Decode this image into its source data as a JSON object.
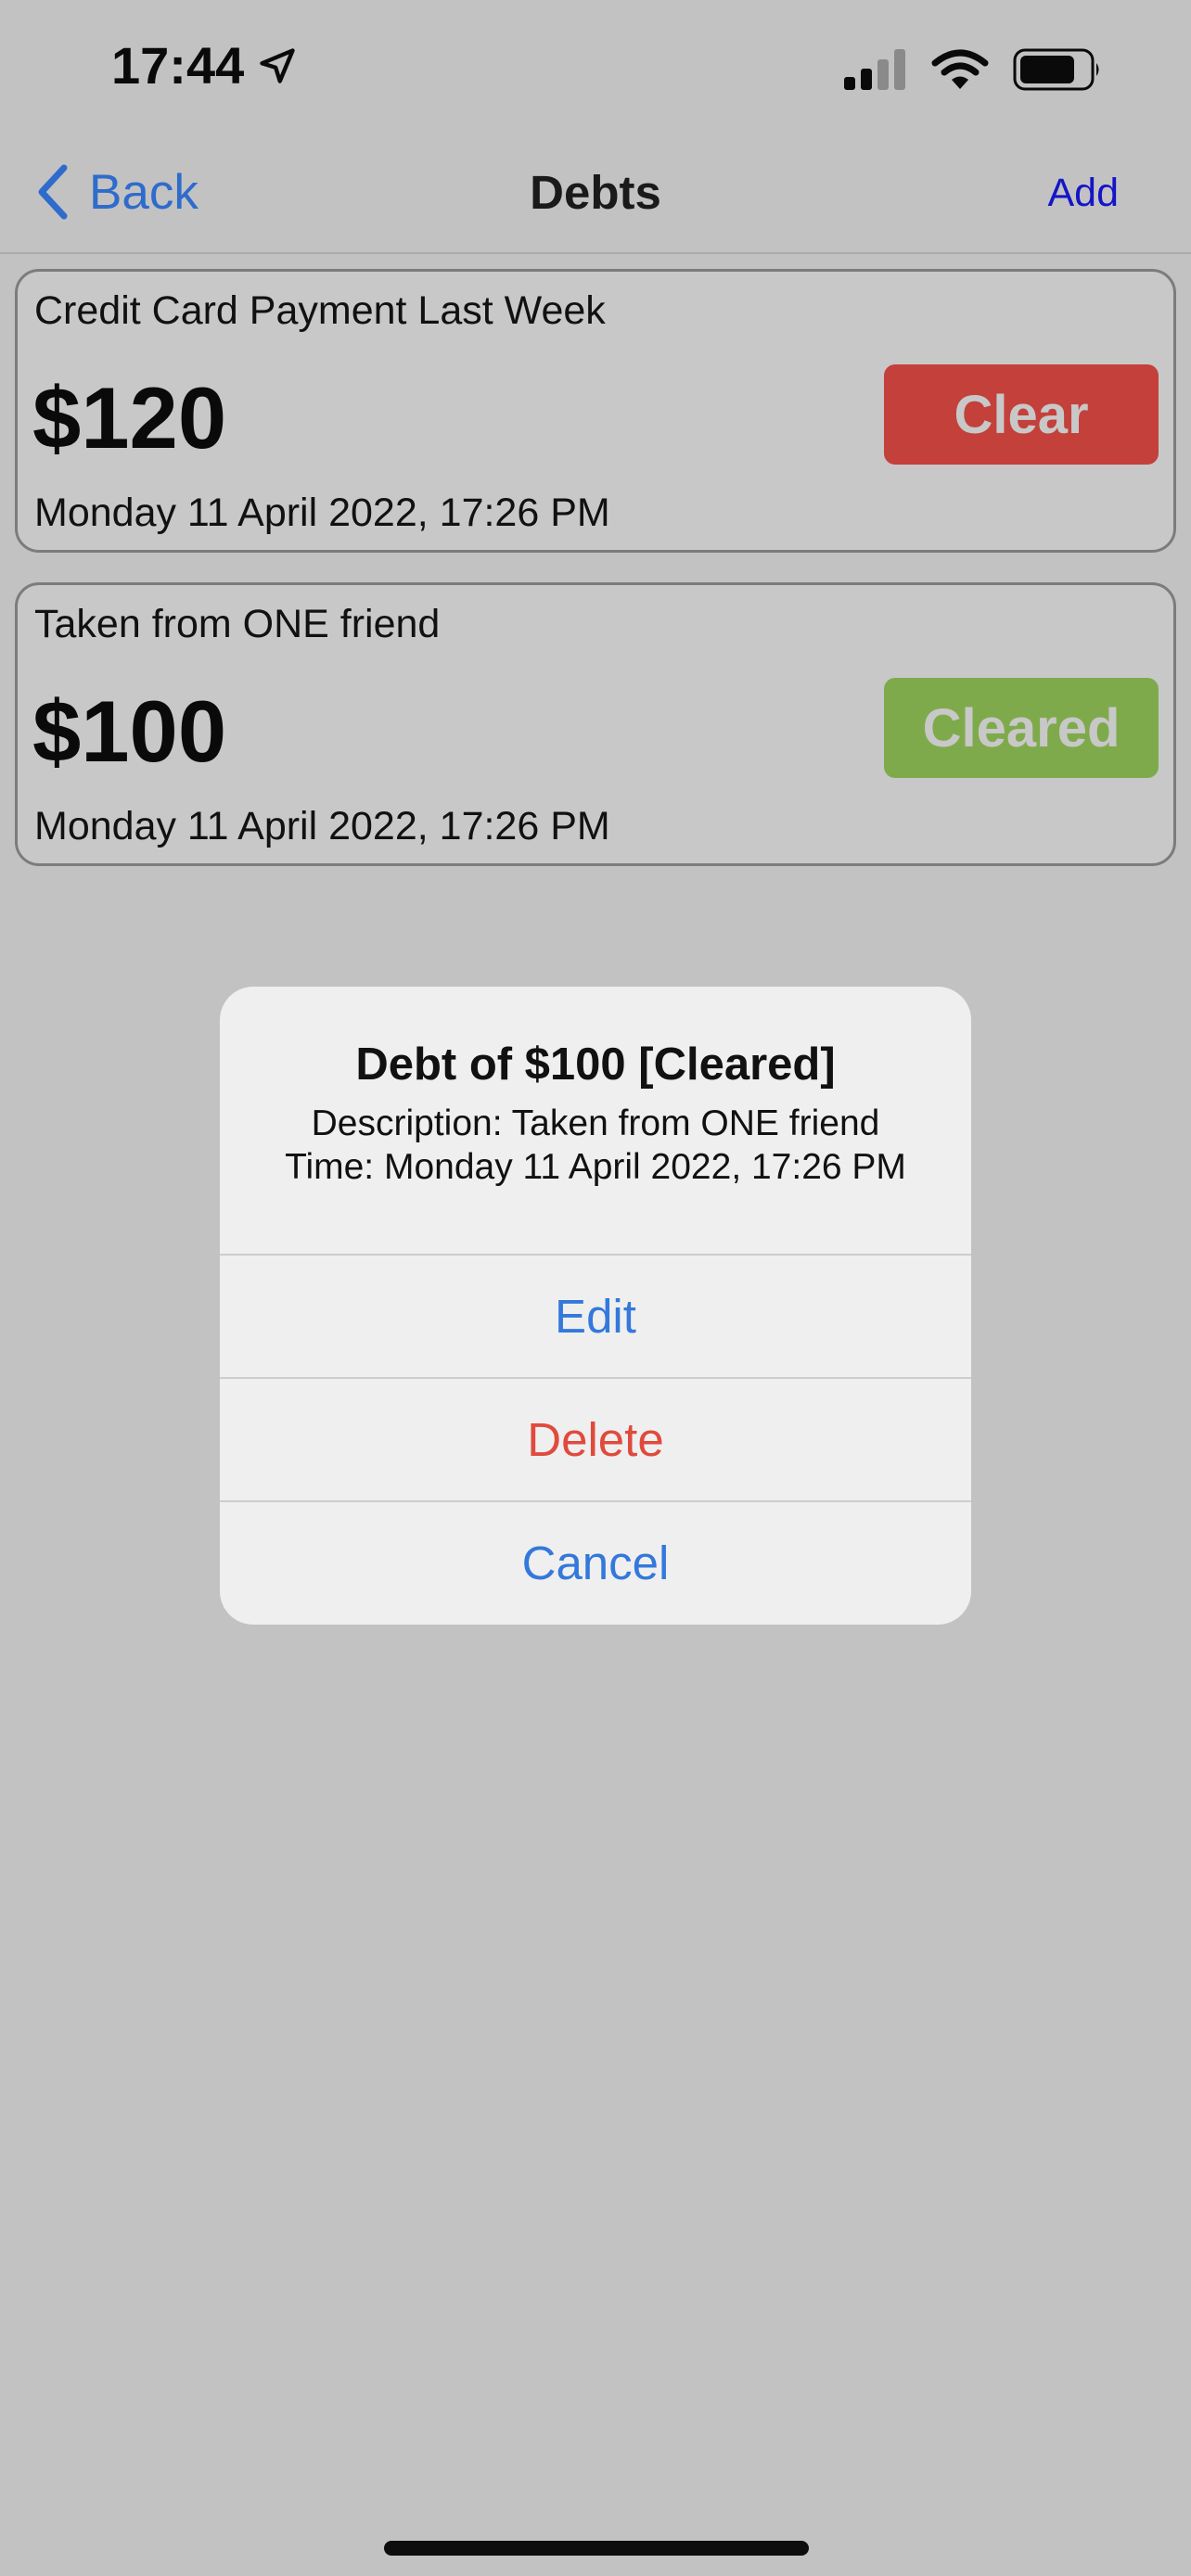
{
  "status_bar": {
    "time": "17:44"
  },
  "nav": {
    "back_label": "Back",
    "title": "Debts",
    "add_label": "Add"
  },
  "debts": [
    {
      "description": "Credit Card Payment Last Week",
      "amount": "$120",
      "time": "Monday 11 April 2022, 17:26 PM",
      "action_label": "Clear",
      "action_color": "#c4403a"
    },
    {
      "description": "Taken from ONE friend",
      "amount": "$100",
      "time": "Monday 11 April 2022, 17:26 PM",
      "action_label": "Cleared",
      "action_color": "#7faa4c"
    }
  ],
  "alert": {
    "title": "Debt of $100 [Cleared]",
    "description": "Description: Taken from ONE friend",
    "time": "Time: Monday 11 April 2022, 17:26 PM",
    "actions": [
      {
        "label": "Edit",
        "color": "#3478dc"
      },
      {
        "label": "Delete",
        "color": "#e04a3c"
      },
      {
        "label": "Cancel",
        "color": "#3478dc"
      }
    ]
  },
  "icons": [
    "location-arrow-icon",
    "cellular-signal-icon",
    "wifi-icon",
    "battery-icon",
    "chevron-left-icon"
  ]
}
